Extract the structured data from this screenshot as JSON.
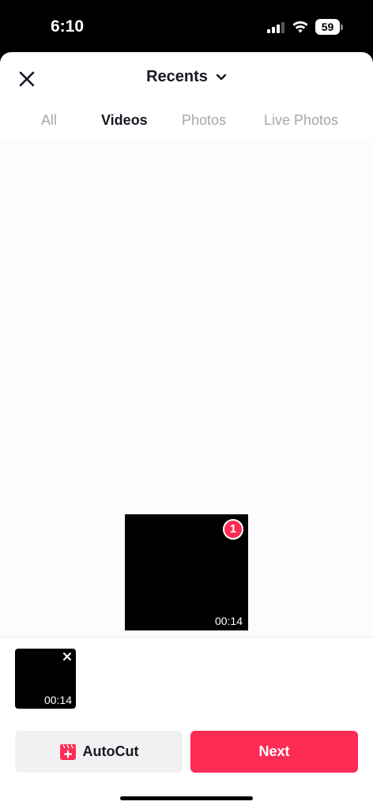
{
  "status_bar": {
    "time": "6:10",
    "battery": "59"
  },
  "header": {
    "title": "Recents"
  },
  "tabs": [
    {
      "label": "All",
      "active": false
    },
    {
      "label": "Videos",
      "active": true
    },
    {
      "label": "Photos",
      "active": false
    },
    {
      "label": "Live Photos",
      "active": false
    }
  ],
  "grid": {
    "items": [
      {
        "duration": "00:14",
        "selection_index": "1"
      }
    ]
  },
  "selection_tray": {
    "items": [
      {
        "duration": "00:14"
      }
    ]
  },
  "actions": {
    "autocut_label": "AutoCut",
    "next_label": "Next"
  },
  "colors": {
    "accent": "#fe2c55",
    "text_primary": "#161823",
    "text_muted": "#a6a7ab",
    "secondary_button_bg": "#f1f1f2"
  },
  "icons": [
    "close-icon",
    "chevron-down-icon",
    "autocut-icon",
    "remove-icon",
    "signal-icon",
    "wifi-icon",
    "battery-icon"
  ]
}
